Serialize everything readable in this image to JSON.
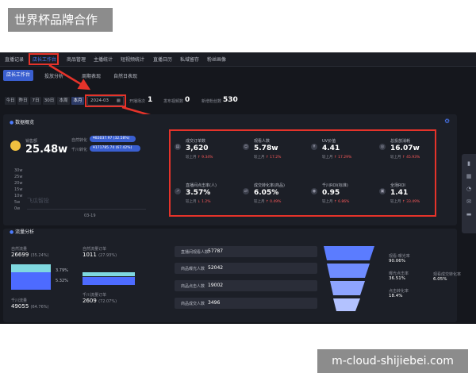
{
  "captions": {
    "top_left": "世界杯品牌合作",
    "bottom_right": "m-cloud-shijiebei.com"
  },
  "topnav": [
    "直播记录",
    "店长工作台",
    "商品管理",
    "主播统计",
    "短视频统计",
    "直播日历",
    "私域留存",
    "粉丝画像"
  ],
  "subtabs": [
    "店长工作台",
    "投放分析",
    "周期表现",
    "自然日表现"
  ],
  "filters": {
    "chips": [
      "今日",
      "昨日",
      "7日",
      "30日",
      "本周",
      "本月"
    ],
    "date": "2024-03",
    "stats": [
      {
        "label": "开播场次",
        "value": "1"
      },
      {
        "label": "发布视频数",
        "value": "0"
      },
      {
        "label": "新增粉丝数",
        "value": "530"
      }
    ]
  },
  "overview": {
    "title": "数据概览",
    "sales_label": "销售额",
    "sales_value": "25.48w",
    "natural": {
      "label": "自然转化",
      "value": "¥83037.97 (32.58%)",
      "share": 0.3258
    },
    "paid": {
      "label": "千川转化",
      "value": "¥171785.74 (67.42%)",
      "share": 0.6742
    },
    "chart_y_ticks": [
      "30w",
      "25w",
      "20w",
      "15w",
      "10w",
      "5w",
      "0w"
    ],
    "chart_x_label": "03-19",
    "watermark": "飞瓜智投"
  },
  "metrics": [
    {
      "label": "成交订单数",
      "value": "3,620",
      "sub": "较上月",
      "change": "↑ 9.34%"
    },
    {
      "label": "观看人数",
      "value": "5.78w",
      "sub": "较上月",
      "change": "↑ 17.2%"
    },
    {
      "label": "UV价值",
      "value": "4.41",
      "sub": "较上月",
      "change": "↑ 17.29%"
    },
    {
      "label": "总投放消耗",
      "value": "16.07w",
      "sub": "较上月",
      "change": "↑ 45.93%"
    },
    {
      "label": "直播间点击率(人)",
      "value": "3.57%",
      "sub": "较上月",
      "change": "↓ 1.2%"
    },
    {
      "label": "成交转化率(商品)",
      "value": "6.05%",
      "sub": "较上月",
      "change": "↑ 0.49%"
    },
    {
      "label": "千川ROI(标准)",
      "value": "0.95",
      "sub": "较上月",
      "change": "↑ 6.86%"
    },
    {
      "label": "全场ROI",
      "value": "1.41",
      "sub": "较上月",
      "change": "↑ 33.49%"
    }
  ],
  "traffic": {
    "title": "流量分析",
    "natural_label": "自然流量",
    "natural_value": "26699",
    "natural_pct": "(35.24%)",
    "natural_orders_label": "自然流量订单",
    "natural_orders_value": "1011",
    "natural_orders_pct": "(27.93%)",
    "mid_pct_1": "3.79%",
    "mid_pct_2": "5.32%",
    "paid_label": "千川流量",
    "paid_value": "49055",
    "paid_pct": "(64.76%)",
    "paid_orders_label": "千川流量订单",
    "paid_orders_value": "2609",
    "paid_orders_pct": "(72.07%)"
  },
  "funnel": [
    {
      "label": "直播间观看人数",
      "value": "57787"
    },
    {
      "label": "商品曝光人数",
      "value": "52042"
    },
    {
      "label": "商品点击人数",
      "value": "19002"
    },
    {
      "label": "商品成交人数",
      "value": "3496"
    }
  ],
  "rates": [
    {
      "label": "观看-曝光率",
      "value": "90.06%"
    },
    {
      "label": "曝光点击率",
      "value": "36.51%"
    },
    {
      "label": "点击转化率",
      "value": "18.4%"
    },
    {
      "label": "观看成交转化率",
      "value": "6.05%"
    }
  ],
  "colors": {
    "accent": "#3a5fd0",
    "highlight": "#e5332a",
    "up": "#ff5a5a",
    "natural": "#7fd8e0",
    "paid": "#4d6bff"
  }
}
